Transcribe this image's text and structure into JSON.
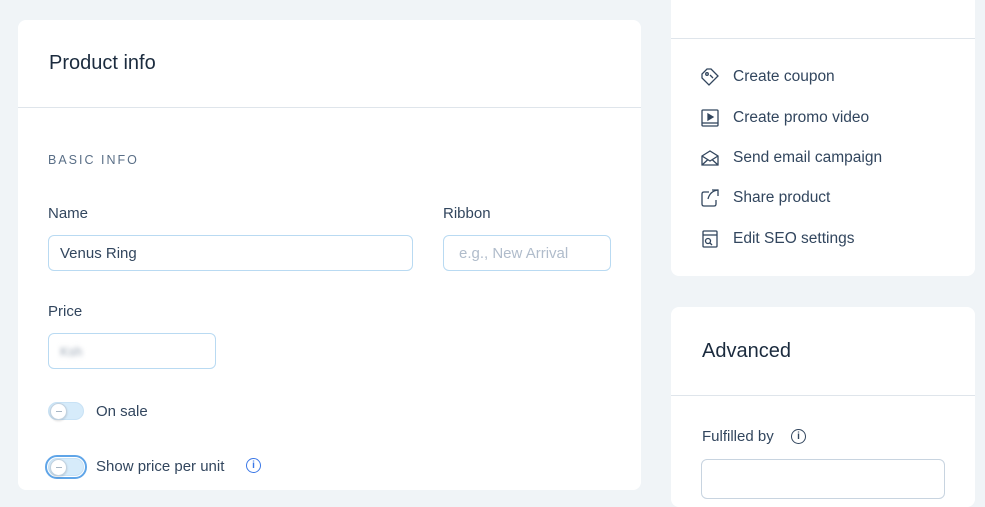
{
  "product_info": {
    "title": "Product info",
    "section_label": "BASIC INFO",
    "name_label": "Name",
    "name_value": "Venus Ring",
    "ribbon_label": "Ribbon",
    "ribbon_placeholder": "e.g., New Arrival",
    "price_label": "Price",
    "price_value": "Ksh",
    "on_sale_label": "On sale",
    "price_per_unit_label": "Show price per unit"
  },
  "actions": {
    "items": [
      {
        "label": "Create coupon",
        "icon": "coupon-icon"
      },
      {
        "label": "Create promo video",
        "icon": "video-icon"
      },
      {
        "label": "Send email campaign",
        "icon": "email-icon"
      },
      {
        "label": "Share product",
        "icon": "share-icon"
      },
      {
        "label": "Edit SEO settings",
        "icon": "seo-icon"
      }
    ]
  },
  "advanced": {
    "title": "Advanced",
    "fulfilled_by_label": "Fulfilled by"
  }
}
